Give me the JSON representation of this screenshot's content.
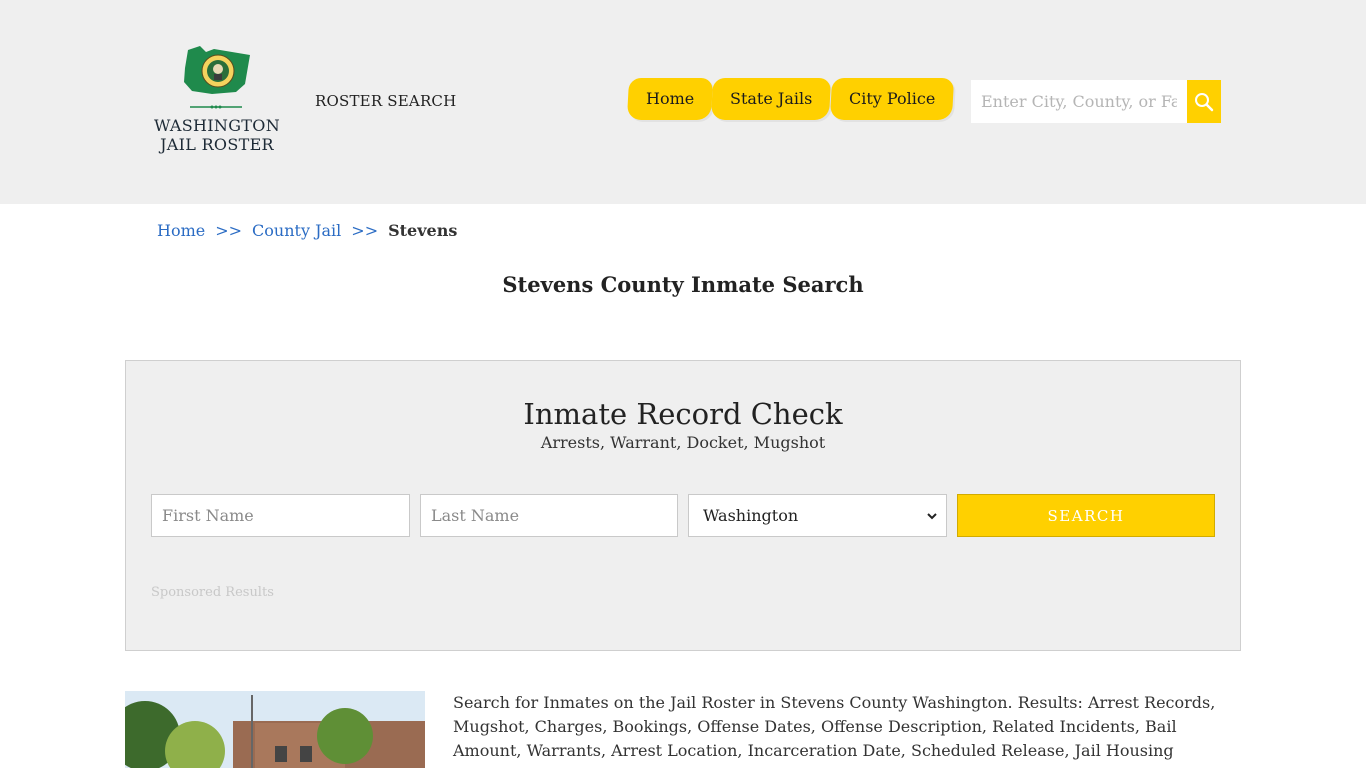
{
  "header": {
    "logo_line1": "WASHINGTON",
    "logo_line2": "JAIL ROSTER",
    "roster_link": "ROSTER SEARCH",
    "nav": [
      "Home",
      "State Jails",
      "City Police"
    ],
    "search_placeholder": "Enter City, County, or Facility"
  },
  "breadcrumb": {
    "home": "Home",
    "sep": ">>",
    "county": "County Jail",
    "current": "Stevens"
  },
  "page_title": "Stevens County Inmate Search",
  "record_check": {
    "title": "Inmate Record Check",
    "subtitle": "Arrests, Warrant, Docket, Mugshot",
    "first_name_placeholder": "First Name",
    "last_name_placeholder": "Last Name",
    "state_selected": "Washington",
    "search_label": "SEARCH",
    "sponsored": "Sponsored Results"
  },
  "description": "Search for Inmates on the Jail Roster in Stevens County Washington. Results: Arrest Records, Mugshot, Charges, Bookings, Offense Dates, Offense Description, Related Incidents, Bail Amount, Warrants, Arrest Location, Incarceration Date, Scheduled Release, Jail Housing Location, Court.",
  "colors": {
    "accent": "#ffd000",
    "header_bg": "#efefef",
    "link": "#2b6cc4",
    "logo_green": "#1f8a4c"
  }
}
